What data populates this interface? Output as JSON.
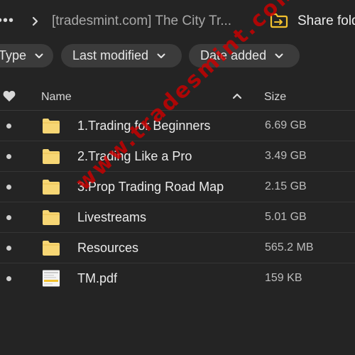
{
  "topbar": {
    "more_glyph": "•••",
    "separator_icon": "chevron-right-icon",
    "folder_title": "[tradesmint.com] The City Tr...",
    "share_icon": "share-folder-icon",
    "share_label": "Share fold"
  },
  "filters": {
    "type_label": "Type",
    "last_modified_label": "Last modified",
    "date_added_label": "Date added",
    "chevron_icon": "chevron-down-icon"
  },
  "table": {
    "header": {
      "favorite_icon": "heart-icon",
      "name_label": "Name",
      "sort_icon": "sort-up-icon",
      "size_label": "Size"
    },
    "rows": [
      {
        "name": "1.Trading for Beginners",
        "size": "6.69 GB",
        "kind": "folder"
      },
      {
        "name": "2.Trading Like a Pro",
        "size": "3.49 GB",
        "kind": "folder"
      },
      {
        "name": "3.Prop Trading Road Map",
        "size": "2.15 GB",
        "kind": "folder"
      },
      {
        "name": "Livestreams",
        "size": "5.01 GB",
        "kind": "folder"
      },
      {
        "name": "Resources",
        "size": "565.2 MB",
        "kind": "folder"
      },
      {
        "name": "TM.pdf",
        "size": "159 KB",
        "kind": "pdf"
      }
    ]
  },
  "watermark": "www.tradesmint.com",
  "colors": {
    "background": "#242424",
    "chip": "#3b3b3b",
    "folder": "#f7d674",
    "share_accent": "#f2c12e",
    "watermark": "#cc0000"
  }
}
